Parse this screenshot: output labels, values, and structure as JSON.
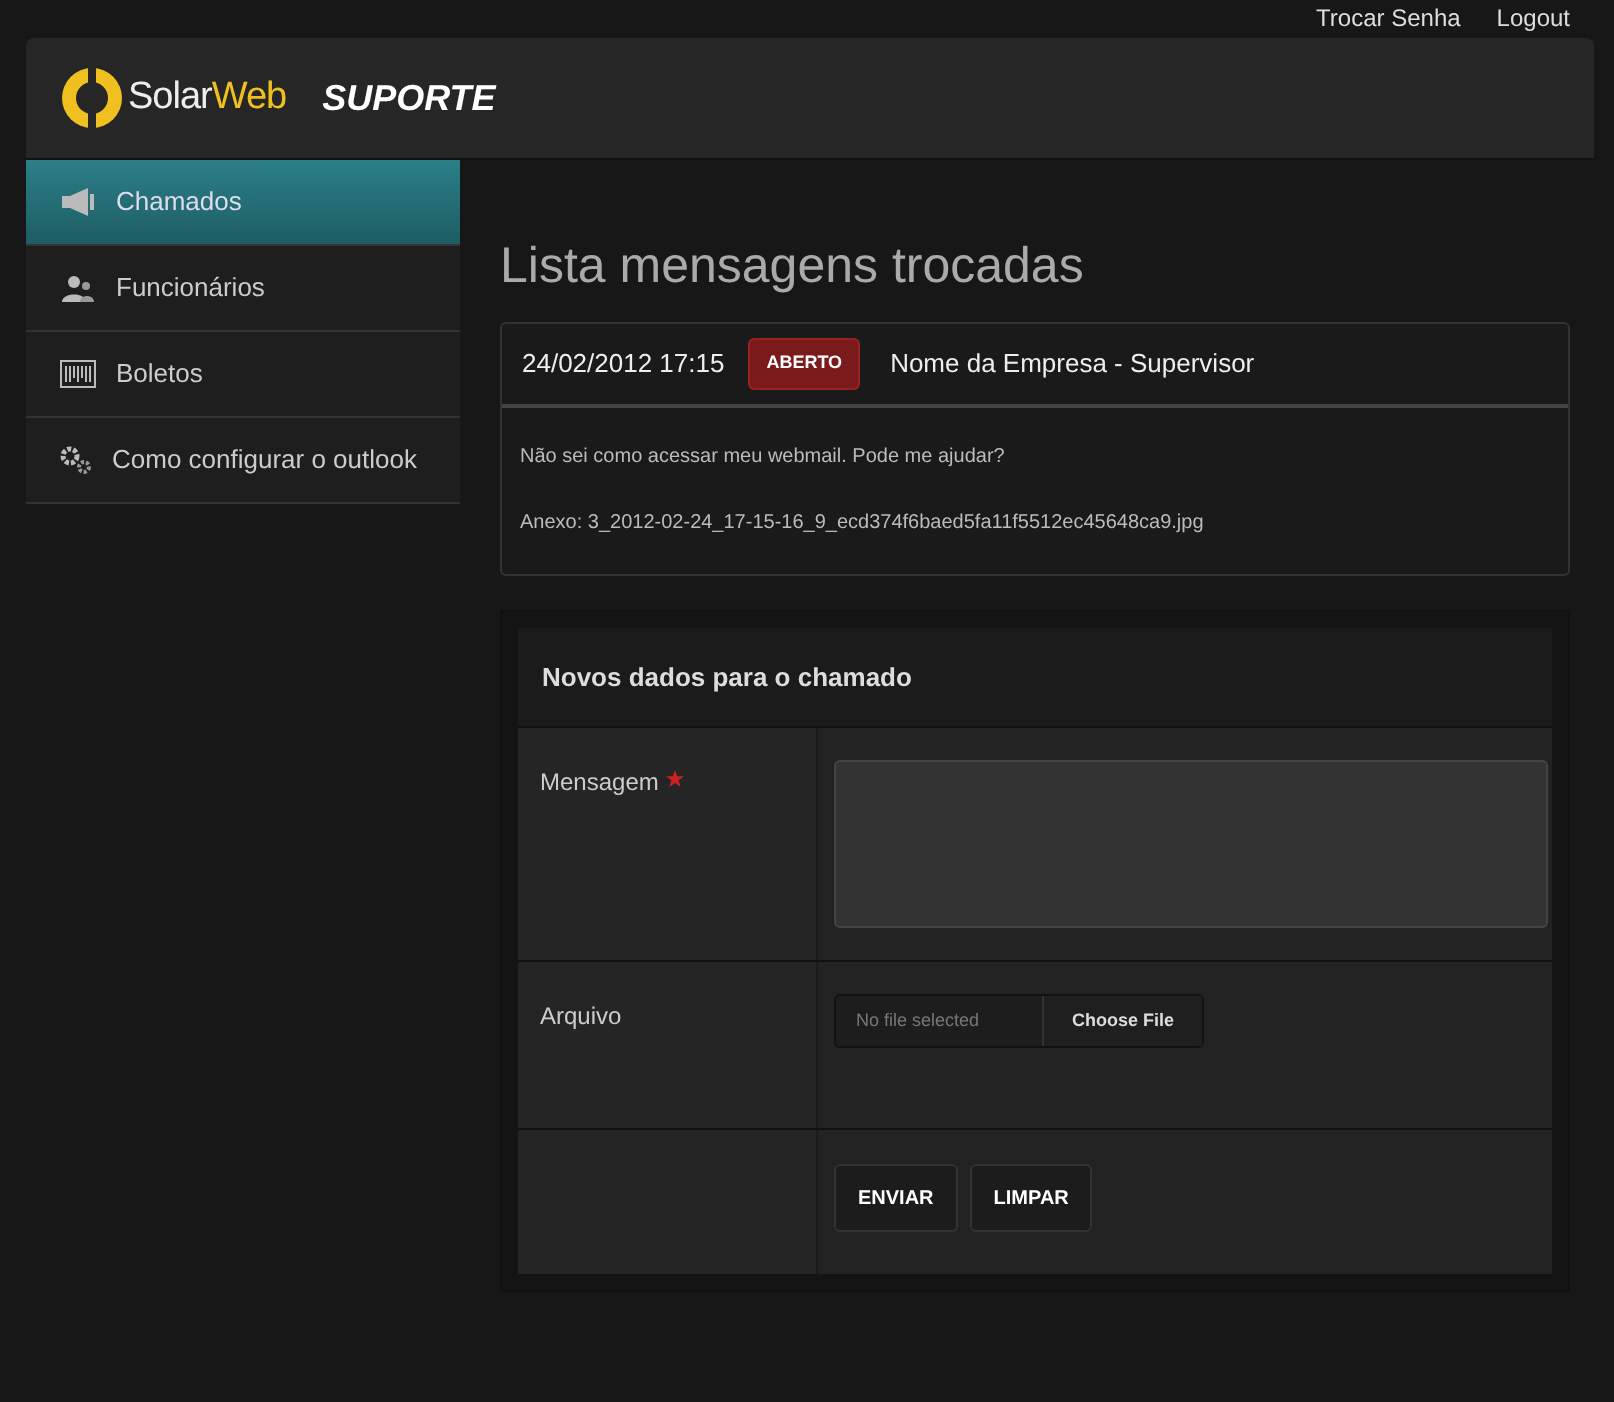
{
  "top_links": [
    "Trocar Senha",
    "Logout"
  ],
  "header": {
    "brand_first": "Solar",
    "brand_second": "Web",
    "section": "SUPORTE"
  },
  "sidebar": {
    "items": [
      {
        "label": "Chamados",
        "kind": "megaphone",
        "selected": true
      },
      {
        "label": "Funcionários",
        "kind": "people",
        "selected": false
      },
      {
        "label": "Boletos",
        "kind": "barcode",
        "selected": false
      },
      {
        "label": "Como configurar o outlook",
        "kind": "gears",
        "selected": false
      }
    ]
  },
  "page_title": "Lista mensagens trocadas",
  "message": {
    "datetime": "24/02/2012 17:15",
    "status": "ABERTO",
    "author": "Nome da Empresa - Supervisor",
    "body": "Não sei como acessar meu webmail. Pode me ajudar?",
    "attachment": "Anexo: 3_2012-02-24_17-15-16_9_ecd374f6baed5fa11f5512ec45648ca9.jpg"
  },
  "form": {
    "title": "Novos dados para o chamado",
    "fields": [
      {
        "kind": "textarea",
        "label": "Mensagem",
        "required": true
      },
      {
        "kind": "file",
        "label": "Arquivo",
        "required": false,
        "status": "No file selected",
        "button": "Choose File"
      }
    ],
    "buttons": [
      "ENVIAR",
      "LIMPAR"
    ]
  }
}
